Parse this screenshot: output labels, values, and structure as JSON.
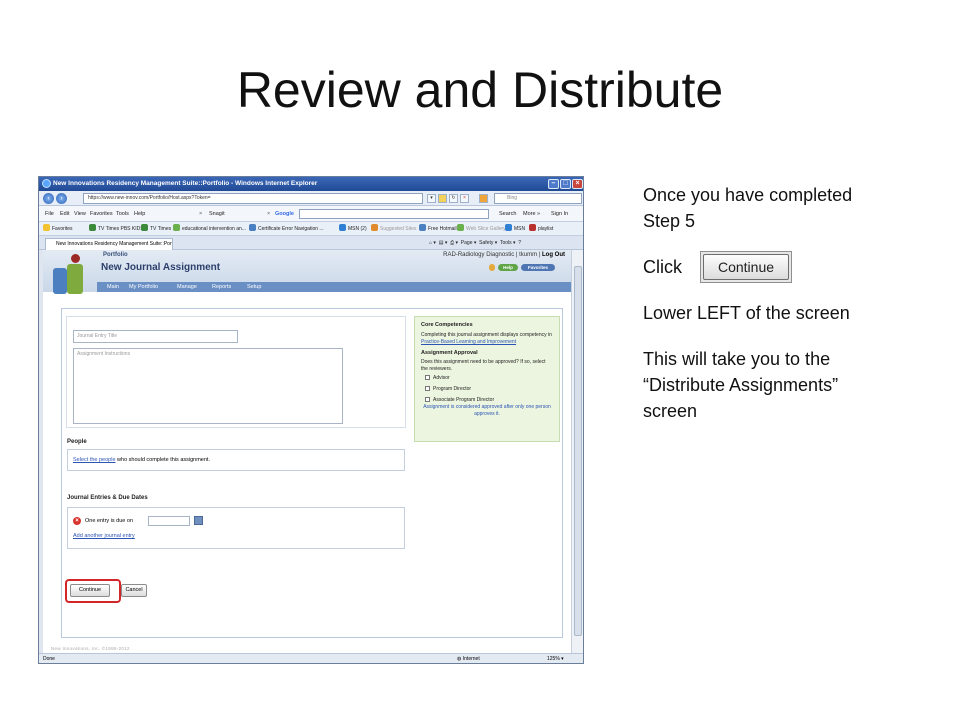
{
  "slide": {
    "title": "Review and Distribute",
    "notes": {
      "step_line1": "Once you have completed",
      "step_line2": "Step 5",
      "click_word": "Click",
      "button_sample": "Continue",
      "location": "Lower LEFT of the screen",
      "result_line1": "This will take you to the",
      "result_line2": "“Distribute Assignments”",
      "result_line3": "screen"
    }
  },
  "browser": {
    "window_title": "New Innovations Residency Management Suite::Portfolio - Windows Internet Explorer",
    "url": "https://www.new-innov.com/Portfolio/Host.aspx?Token=",
    "search_placeholder": "Bing",
    "menu": [
      "File",
      "Edit",
      "View",
      "Favorites",
      "Tools",
      "Help"
    ],
    "toolbar_items": [
      "Snagit",
      "Google",
      "Search",
      "More »",
      "Sign In"
    ],
    "favorites_label": "Favorites",
    "favorites": [
      "TV Times PBS KIDS",
      "TV Times",
      "educational intervention an...",
      "Certificate Error Navigation ...",
      "MSN (2)",
      "Suggested Sites",
      "Free Hotmail",
      "Web Slice Gallery",
      "MSN",
      "playlist"
    ],
    "tab_title": "New Innovations Residency Management Suite::Portf...",
    "tab_tools": [
      "Page ▾",
      "Safety ▾",
      "Tools ▾"
    ],
    "status": {
      "left": "Done",
      "zone": "Internet",
      "zoom": "125%"
    }
  },
  "app": {
    "section": "Portfolio",
    "heading": "New Journal Assignment",
    "user_info": "RAD-Radiology Diagnostic | tkumm |",
    "logout": "Log Out",
    "help": "Help",
    "favorites_btn": "Favorites",
    "nav": [
      "Main",
      "My Portfolio",
      "Manage",
      "Reports",
      "Setup"
    ],
    "form": {
      "title_placeholder": "Journal Entry Title",
      "instructions_placeholder": "Assignment Instructions",
      "core_competencies_heading": "Core Competencies",
      "core_competencies_text": "Completing this journal assignment displays competency in",
      "core_competencies_link": "Practice-Based Learning and Improvement",
      "approval_heading": "Assignment Approval",
      "approval_question": "Does this assignment need to be approved? If so, select the reviewers.",
      "reviewers": [
        "Advisor",
        "Program Director",
        "Associate Program Director"
      ],
      "approval_note": "Assignment is considered approved after only one person approves it.",
      "people_heading": "People",
      "people_link": "Select the people",
      "people_text": "who should complete this assignment.",
      "due_heading": "Journal Entries & Due Dates",
      "due_text": "One entry is due on",
      "add_entry_link": "Add another journal entry",
      "continue_label": "Continue",
      "cancel_label": "Cancel"
    },
    "footer": "New Innovations, Inc. ©1995-2012"
  }
}
